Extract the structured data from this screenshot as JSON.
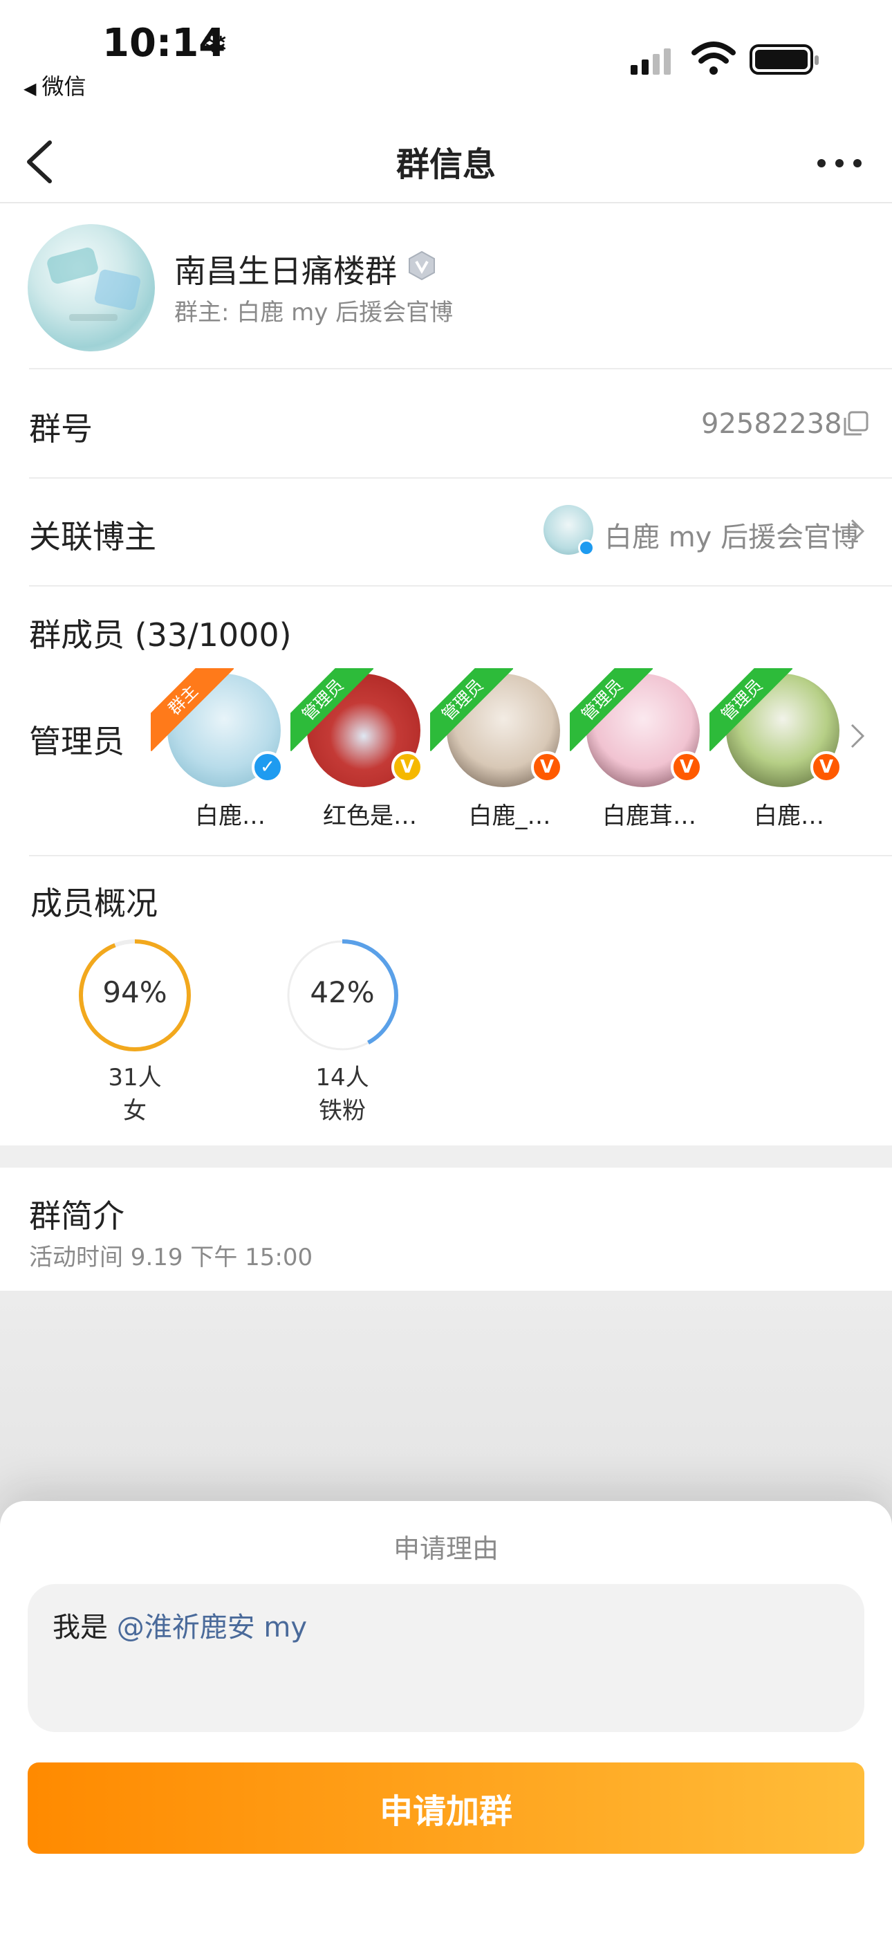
{
  "status_bar": {
    "time": "10:14",
    "back_app": "微信"
  },
  "nav": {
    "title": "群信息"
  },
  "group": {
    "name": "南昌生日痛楼群",
    "owner": "群主: 白鹿 my 后援会官博"
  },
  "group_number": {
    "label": "群号",
    "value": "92582238"
  },
  "linked_blogger": {
    "label": "关联博主",
    "value": "白鹿 my 后援会官博"
  },
  "members": {
    "title": "群成员 (33/1000)",
    "admin_label": "管理员",
    "list": [
      {
        "name": "白鹿…",
        "badge": "群主",
        "badge_color": "#ff7a1a",
        "verify_color": "#1e9bf0"
      },
      {
        "name": "红色是…",
        "badge": "管理员",
        "badge_color": "#2dbb3a",
        "verify_color": "#f5b800"
      },
      {
        "name": "白鹿_…",
        "badge": "管理员",
        "badge_color": "#2dbb3a",
        "verify_color": "#ff5a00"
      },
      {
        "name": "白鹿茸…",
        "badge": "管理员",
        "badge_color": "#2dbb3a",
        "verify_color": "#ff5a00"
      },
      {
        "name": "白鹿…",
        "badge": "管理员",
        "badge_color": "#2dbb3a",
        "verify_color": "#ff5a00"
      }
    ]
  },
  "overview": {
    "title": "成员概况",
    "stats": [
      {
        "percent_label": "94%",
        "fraction": 0.94,
        "count": "31人",
        "label": "女",
        "color": "#f2a81d"
      },
      {
        "percent_label": "42%",
        "fraction": 0.42,
        "count": "14人",
        "label": "铁粉",
        "color": "#5aa0e8"
      }
    ]
  },
  "intro": {
    "title": "群简介",
    "text": "活动时间 9.19 下午 15:00"
  },
  "apply_sheet": {
    "title": "申请理由",
    "reason_prefix": "我是 ",
    "reason_mention": "@淮祈鹿安 my",
    "button_label": "申请加群"
  }
}
